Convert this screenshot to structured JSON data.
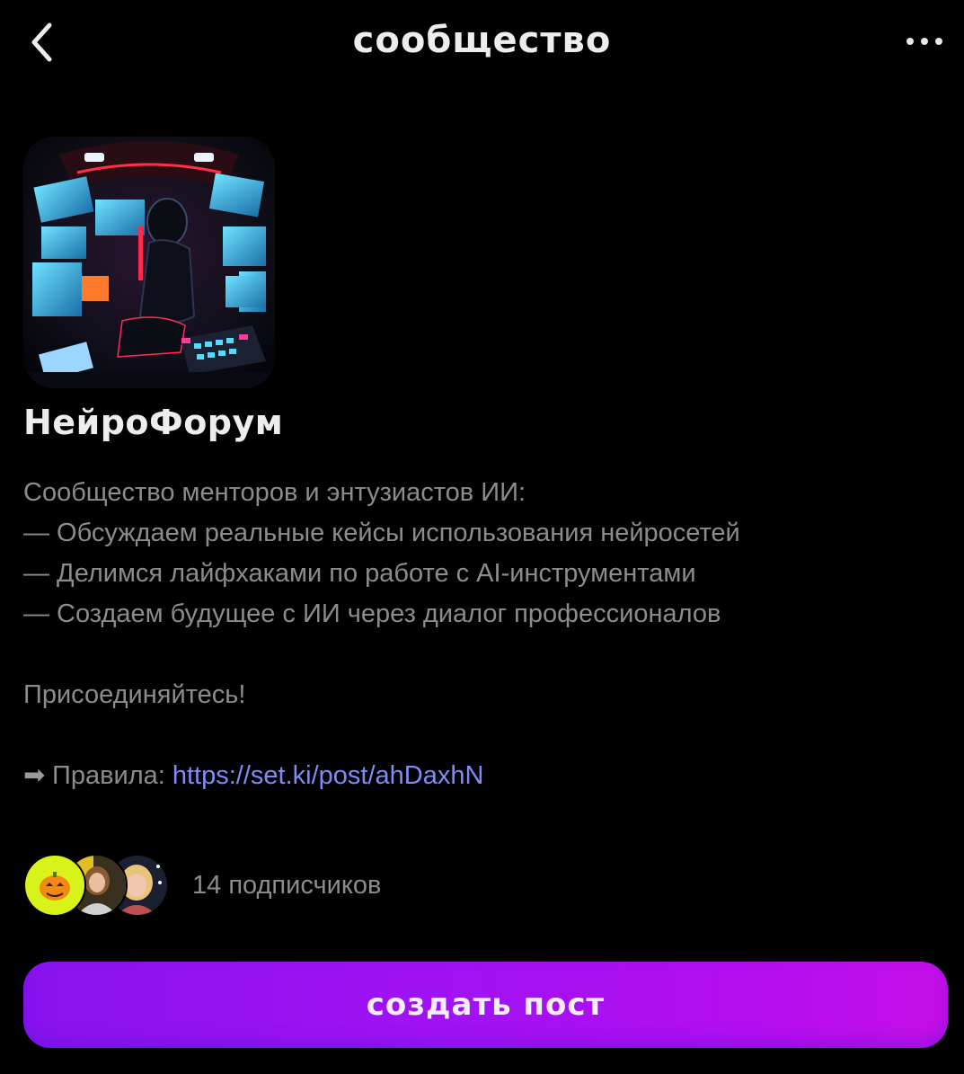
{
  "header": {
    "title": "сообщество",
    "back_icon": "chevron-left-icon",
    "more_icon": "more-dots-icon"
  },
  "community": {
    "name": "НейроФорум",
    "avatar_icon": "community-avatar-image",
    "description_lines": [
      "Сообщество менторов и энтузиастов ИИ:",
      "— Обсуждаем реальные кейсы использования нейросетей",
      "— Делимся лайфхаками по работе с AI-инструментами",
      "— Создаем будущее с ИИ через диалог профессионалов",
      "",
      "Присоединяйтесь!",
      ""
    ],
    "rules_arrow": "➡",
    "rules_label": "Правила: ",
    "rules_link": "https://set.ki/post/ahDaxhN"
  },
  "subscribers": {
    "count_text": "14 подписчиков",
    "avatars": [
      "pumpkin-avatar",
      "member-avatar-2",
      "member-avatar-3"
    ]
  },
  "actions": {
    "create_post_label": "создать пост"
  },
  "colors": {
    "background": "#000000",
    "text_primary": "#ededed",
    "text_secondary": "#8c8c8c",
    "link": "#7f8cf5",
    "button_gradient_start": "#8a12f0",
    "button_gradient_end": "#c50fe6"
  }
}
